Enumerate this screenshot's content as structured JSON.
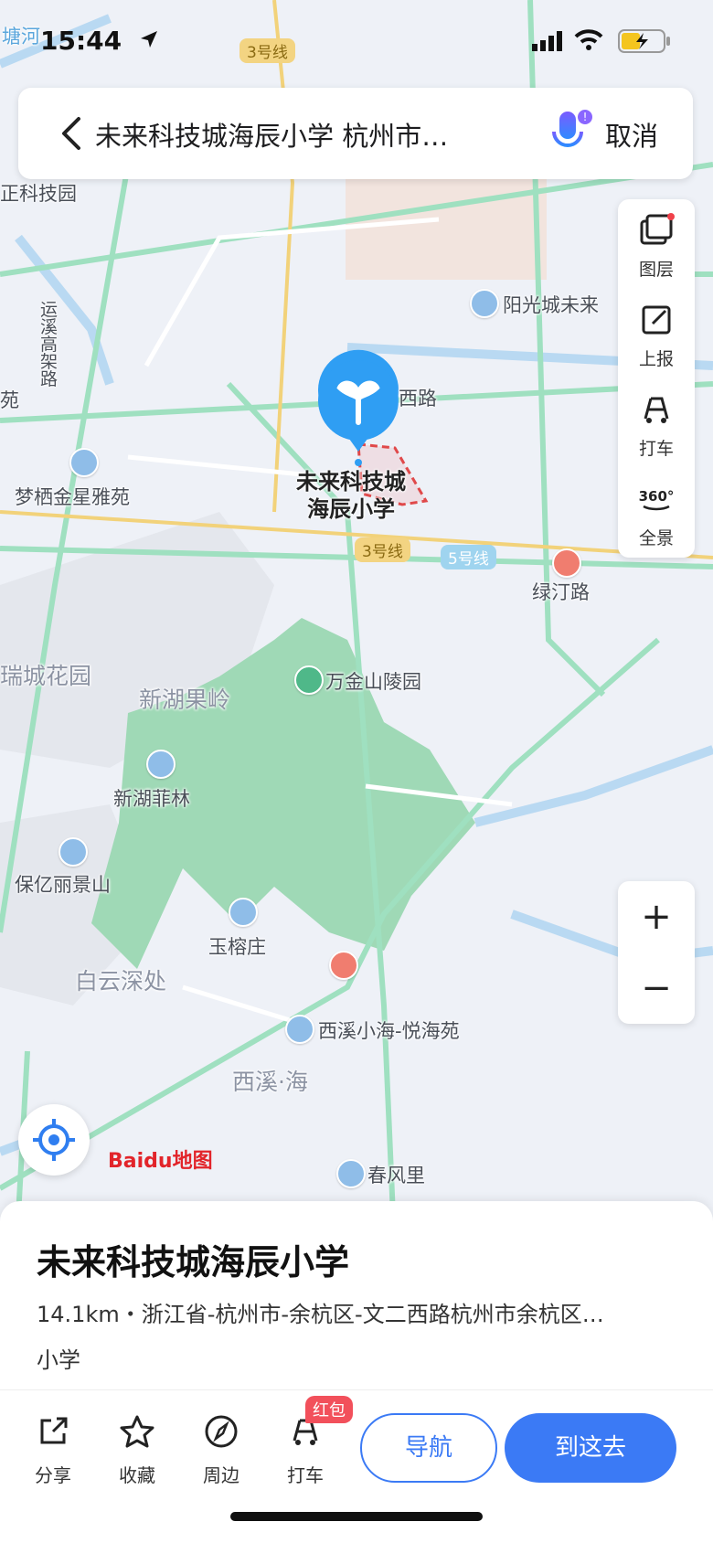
{
  "status_bar": {
    "time": "15:44"
  },
  "search": {
    "query": "未来科技城海辰小学 杭州市…",
    "cancel_label": "取消"
  },
  "map": {
    "selected_poi": {
      "line1": "未来科技城",
      "line2": "海辰小学"
    },
    "labels": {
      "tangriver": "塘河",
      "keji": "正科技园",
      "yuanxi": "运溪高架路",
      "xilu": "西路",
      "yangguang": "阳光城未来",
      "mengqi": "梦栖金星雅苑",
      "lvting": "绿汀路",
      "ruicheng": "瑞城花园",
      "xinhu": "新湖果岭",
      "wanjin": "万金山陵园",
      "feilin": "新湖菲林",
      "baoli": "保亿丽景山",
      "yurong": "玉榕庄",
      "baiyun": "白云深处",
      "xixi_xiaohai": "西溪小海-悦海苑",
      "xixi_hai": "西溪·海",
      "chunfeng": "春风里",
      "yuan": "苑"
    },
    "line_tags": {
      "l3_top": "3号线",
      "l3": "3号线",
      "l5": "5号线"
    },
    "logo": "Baidu地图"
  },
  "tools": {
    "layers": "图层",
    "report": "上报",
    "taxi": "打车",
    "panorama": "全景"
  },
  "zoom": {
    "in": "+",
    "out": "−"
  },
  "place": {
    "name": "未来科技城海辰小学",
    "address": "14.1km・浙江省-杭州市-余杭区-文二西路杭州市余杭区…",
    "category": "小学"
  },
  "actions": {
    "share": "分享",
    "favorite": "收藏",
    "nearby": "周边",
    "taxi": "打车",
    "badge": "红包"
  },
  "buttons": {
    "navigate": "导航",
    "go": "到这去"
  }
}
